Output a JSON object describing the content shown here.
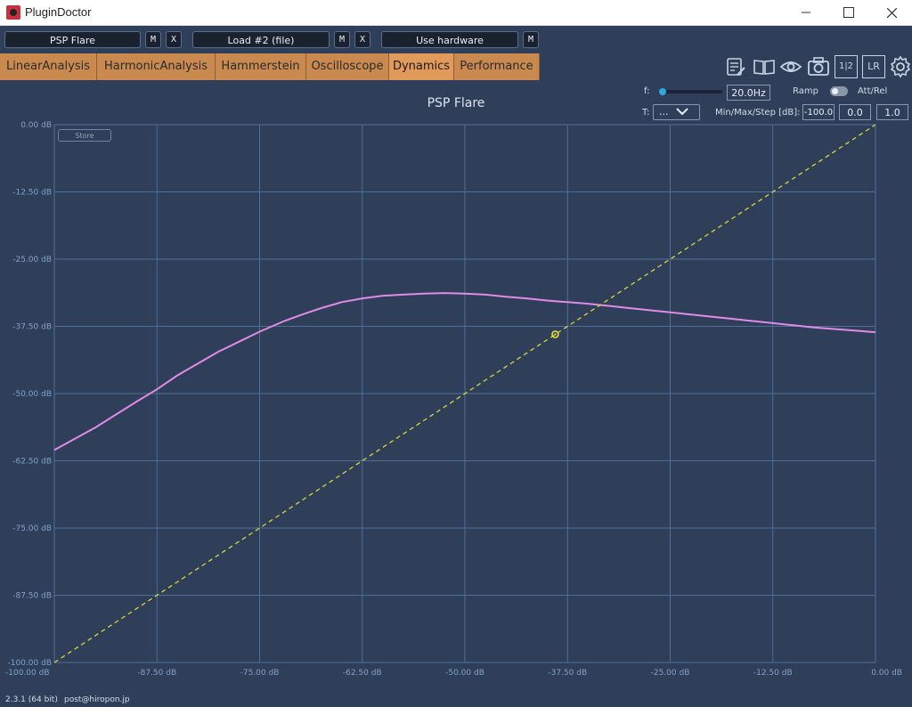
{
  "window": {
    "title": "PluginDoctor"
  },
  "topbar": {
    "plugin1": {
      "label": "PSP Flare",
      "m": "M",
      "x": "X"
    },
    "plugin2": {
      "label": "Load #2 (file)",
      "m": "M",
      "x": "X"
    },
    "hardware": {
      "label": "Use hardware",
      "m": "M"
    }
  },
  "tabs": [
    {
      "label": "LinearAnalysis"
    },
    {
      "label": "HarmonicAnalysis"
    },
    {
      "label": "Hammerstein"
    },
    {
      "label": "Oscilloscope"
    },
    {
      "label": "Dynamics",
      "active": true
    },
    {
      "label": "Performance"
    }
  ],
  "tool_icons": [
    "notes-icon",
    "book-icon",
    "eye-icon",
    "camera-icon",
    "channel-1-2-icon",
    "lr-icon",
    "gear-icon"
  ],
  "tool_icon_text": {
    "channels": "1|2",
    "lr": "LR"
  },
  "controls": {
    "f_label": "f:",
    "f_value": "20.0Hz",
    "f_slider_fraction": 0.03,
    "ramp_label": "Ramp",
    "attrel_label": "Att/Rel",
    "t_label": "T:",
    "t_value": "...",
    "minmax_label": "Min/Max/Step [dB]:",
    "min_value": "-100.0",
    "max_value": "0.0",
    "step_value": "1.0"
  },
  "plot": {
    "store_label": "Store"
  },
  "chart_data": {
    "type": "line",
    "title": "PSP Flare",
    "xlabel": "",
    "ylabel": "",
    "xlim": [
      -100,
      0
    ],
    "ylim": [
      -100,
      0
    ],
    "x_ticks": [
      -100,
      -87.5,
      -75,
      -62.5,
      -50,
      -37.5,
      -25,
      -12.5,
      0
    ],
    "y_ticks": [
      0,
      -12.5,
      -25,
      -37.5,
      -50,
      -62.5,
      -75,
      -87.5,
      -100
    ],
    "x_tick_labels": [
      "-100.00 dB",
      "-87.50 dB",
      "-75.00 dB",
      "-62.50 dB",
      "-50.00 dB",
      "-37.50 dB",
      "-25.00 dB",
      "-12.50 dB",
      "0.00 dB"
    ],
    "y_tick_labels": [
      "0.00 dB",
      "-12.50 dB",
      "-25.00 dB",
      "-37.50 dB",
      "-50.00 dB",
      "-62.50 dB",
      "-75.00 dB",
      "-87.50 dB",
      "-100.00 dB"
    ],
    "grid": true,
    "series": [
      {
        "color": "#e28ae8",
        "style": "solid",
        "x": [
          -100,
          -95,
          -90,
          -87.5,
          -85,
          -80,
          -75,
          -72,
          -70,
          -67.5,
          -65,
          -62.5,
          -60,
          -57.5,
          -55,
          -52.5,
          -50,
          -47.5,
          -45,
          -42.5,
          -40,
          -37.5,
          -35,
          -32.5,
          -30,
          -27.5,
          -25,
          -22.5,
          -20,
          -17.5,
          -15,
          -12.5,
          -10,
          -7.5,
          -5,
          -2.5,
          0
        ],
        "y": [
          -60.5,
          -56.3,
          -51.5,
          -49.2,
          -46.6,
          -42.2,
          -38.5,
          -36.5,
          -35.4,
          -34.1,
          -33.0,
          -32.3,
          -31.8,
          -31.6,
          -31.4,
          -31.3,
          -31.4,
          -31.6,
          -32.0,
          -32.3,
          -32.7,
          -33.0,
          -33.3,
          -33.7,
          -34.1,
          -34.5,
          -34.9,
          -35.3,
          -35.7,
          -36.1,
          -36.5,
          -36.9,
          -37.3,
          -37.7,
          -38.0,
          -38.3,
          -38.6
        ]
      },
      {
        "color": "#d9d438",
        "style": "dashed",
        "x": [
          -100,
          0
        ],
        "y": [
          -100,
          0
        ]
      }
    ],
    "marker": {
      "x": -39,
      "y": -39,
      "color": "#e8e83a"
    }
  },
  "footer": {
    "version": "2.3.1 (64 bit)",
    "email": "post@hiropon.jp"
  }
}
